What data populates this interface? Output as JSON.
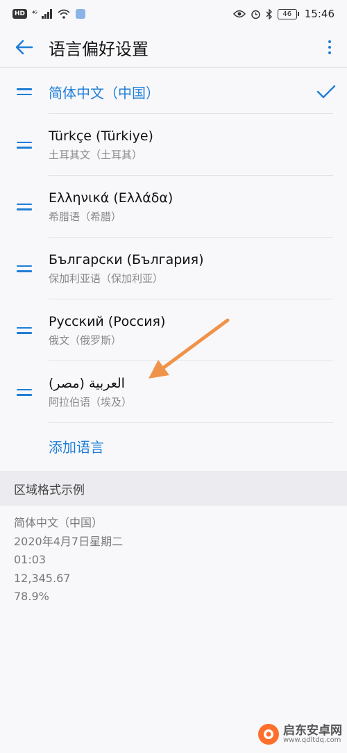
{
  "status_bar": {
    "hd": "HD",
    "network": "⁴ᴳ",
    "battery": "46",
    "time": "15:46"
  },
  "app_bar": {
    "title": "语言偏好设置"
  },
  "languages": [
    {
      "name": "简体中文（中国）",
      "sub": "",
      "selected": true
    },
    {
      "name": "Türkçe (Türkiye)",
      "sub": "土耳其文（土耳其）",
      "selected": false
    },
    {
      "name": "Ελληνικά (Ελλάδα)",
      "sub": "希腊语（希腊）",
      "selected": false
    },
    {
      "name": "Български (България)",
      "sub": "保加利亚语（保加利亚）",
      "selected": false
    },
    {
      "name": "Русский (Россия)",
      "sub": "俄文（俄罗斯）",
      "selected": false
    },
    {
      "name": "العربية (مصر)",
      "sub": "阿拉伯语（埃及）",
      "selected": false
    }
  ],
  "add_language": "添加语言",
  "region": {
    "header": "区域格式示例",
    "examples": [
      "简体中文（中国）",
      "2020年4月7日星期二",
      "01:03",
      "12,345.67",
      "78.9%"
    ]
  },
  "watermark": {
    "name": "启东安卓网",
    "url": "www.qdltdq.com"
  },
  "colors": {
    "accent": "#1f7ed6",
    "annotation_arrow": "#f0934a"
  }
}
